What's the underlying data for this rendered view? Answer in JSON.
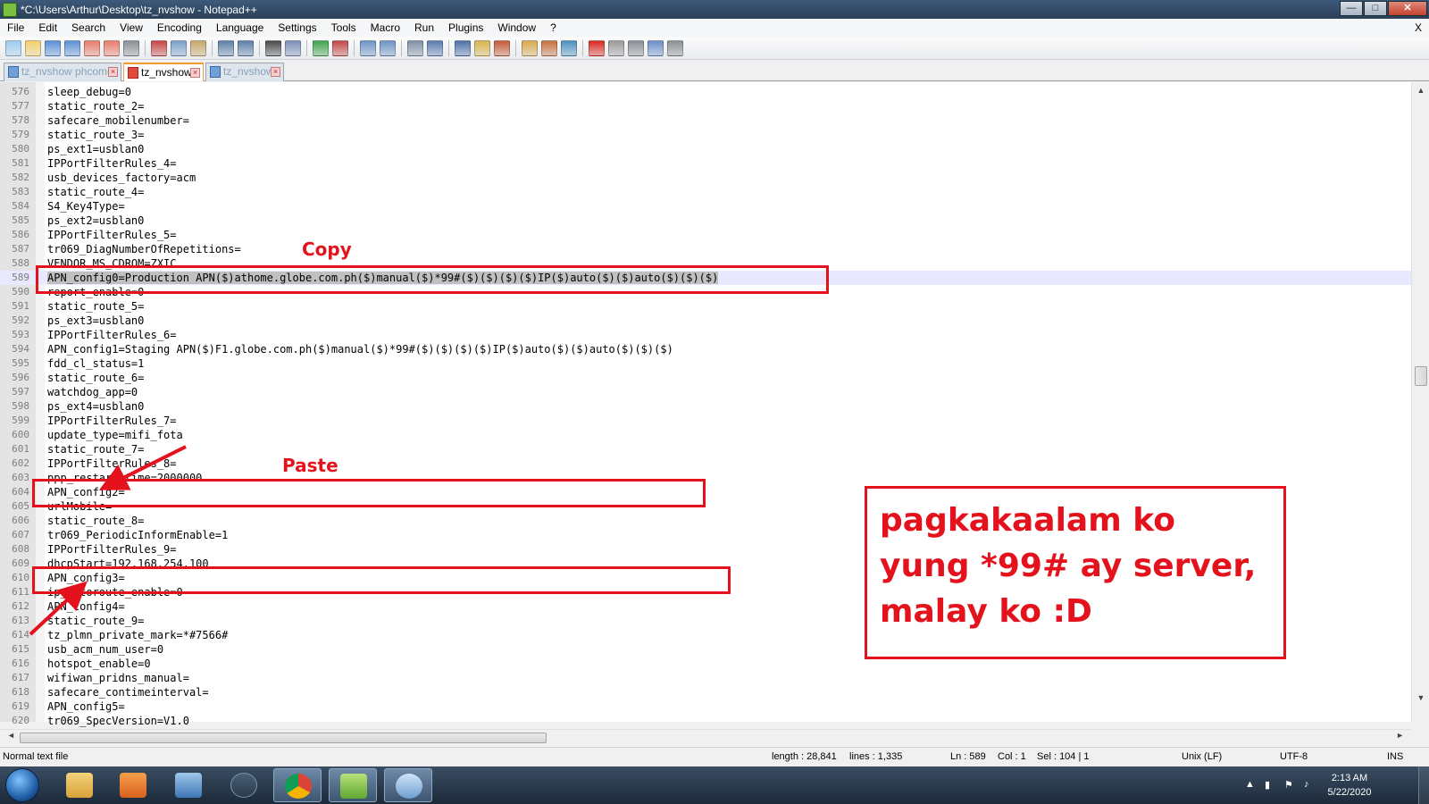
{
  "window": {
    "title": "*C:\\Users\\Arthur\\Desktop\\tz_nvshow - Notepad++",
    "controls": {
      "minimize": "—",
      "maximize": "□",
      "close": "✕"
    }
  },
  "menu": {
    "items": [
      "File",
      "Edit",
      "Search",
      "View",
      "Encoding",
      "Language",
      "Settings",
      "Tools",
      "Macro",
      "Run",
      "Plugins",
      "Window",
      "?"
    ],
    "doc_close": "X"
  },
  "toolbar": {
    "icons": [
      "new-file-icon",
      "open-file-icon",
      "save-icon",
      "save-all-icon",
      "close-icon",
      "close-all-icon",
      "print-icon",
      "cut-icon",
      "copy-icon",
      "paste-icon",
      "undo-icon",
      "redo-icon",
      "find-icon",
      "replace-icon",
      "zoom-in-icon",
      "zoom-out-icon",
      "sync-vertical-icon",
      "sync-horizontal-icon",
      "word-wrap-icon",
      "show-all-chars-icon",
      "indent-guide-icon",
      "udl-icon",
      "doc-map-icon",
      "function-list-icon",
      "folder-workspace-icon",
      "monitoring-icon",
      "record-macro-icon",
      "stop-macro-icon",
      "play-macro-icon",
      "run-macro-multiple-icon",
      "save-macro-icon"
    ]
  },
  "tabs": [
    {
      "label": "tz_nvshow phcomer",
      "active": false
    },
    {
      "label": "tz_nvshow",
      "active": true
    },
    {
      "label": "tz_nvshow",
      "active": false
    }
  ],
  "editor": {
    "current_line": "589",
    "lines": [
      {
        "n": "576",
        "text": "sleep_debug=0"
      },
      {
        "n": "577",
        "text": "static_route_2="
      },
      {
        "n": "578",
        "text": "safecare_mobilenumber="
      },
      {
        "n": "579",
        "text": "static_route_3="
      },
      {
        "n": "580",
        "text": "ps_ext1=usblan0"
      },
      {
        "n": "581",
        "text": "IPPortFilterRules_4="
      },
      {
        "n": "582",
        "text": "usb_devices_factory=acm"
      },
      {
        "n": "583",
        "text": "static_route_4="
      },
      {
        "n": "584",
        "text": "S4_Key4Type="
      },
      {
        "n": "585",
        "text": "ps_ext2=usblan0"
      },
      {
        "n": "586",
        "text": "IPPortFilterRules_5="
      },
      {
        "n": "587",
        "text": "tr069_DiagNumberOfRepetitions="
      },
      {
        "n": "588",
        "text": "VENDOR_MS_CDROM=ZXIC"
      },
      {
        "n": "589",
        "text": "APN_config0=Production APN($)athome.globe.com.ph($)manual($)*99#($)($)($)($)IP($)auto($)($)auto($)($)($)"
      },
      {
        "n": "590",
        "text": "report_enable=0"
      },
      {
        "n": "591",
        "text": "static_route_5="
      },
      {
        "n": "592",
        "text": "ps_ext3=usblan0"
      },
      {
        "n": "593",
        "text": "IPPortFilterRules_6="
      },
      {
        "n": "594",
        "text": "APN_config1=Staging APN($)F1.globe.com.ph($)manual($)*99#($)($)($)($)IP($)auto($)($)auto($)($)($)"
      },
      {
        "n": "595",
        "text": "fdd_cl_status=1"
      },
      {
        "n": "596",
        "text": "static_route_6="
      },
      {
        "n": "597",
        "text": "watchdog_app=0"
      },
      {
        "n": "598",
        "text": "ps_ext4=usblan0"
      },
      {
        "n": "599",
        "text": "IPPortFilterRules_7="
      },
      {
        "n": "600",
        "text": "update_type=mifi_fota"
      },
      {
        "n": "601",
        "text": "static_route_7="
      },
      {
        "n": "602",
        "text": "IPPortFilterRules_8="
      },
      {
        "n": "603",
        "text": "ppp_restart_time=2000000"
      },
      {
        "n": "604",
        "text": "APN_config2="
      },
      {
        "n": "605",
        "text": "urlMobile="
      },
      {
        "n": "606",
        "text": "static_route_8="
      },
      {
        "n": "607",
        "text": "tr069_PeriodicInformEnable=1"
      },
      {
        "n": "608",
        "text": "IPPortFilterRules_9="
      },
      {
        "n": "609",
        "text": "dhcpStart=192.168.254.100"
      },
      {
        "n": "610",
        "text": "APN_config3="
      },
      {
        "n": "611",
        "text": "ip_autoroute_enable=0"
      },
      {
        "n": "612",
        "text": "APN_config4="
      },
      {
        "n": "613",
        "text": "static_route_9="
      },
      {
        "n": "614",
        "text": "tz_plmn_private_mark=*#7566#"
      },
      {
        "n": "615",
        "text": "usb_acm_num_user=0"
      },
      {
        "n": "616",
        "text": "hotspot_enable=0"
      },
      {
        "n": "617",
        "text": "wifiwan_pridns_manual="
      },
      {
        "n": "618",
        "text": "safecare_contimeinterval="
      },
      {
        "n": "619",
        "text": "APN_config5="
      },
      {
        "n": "620",
        "text": "tr069_SpecVersion=V1.0"
      }
    ]
  },
  "scrollbar": {
    "up": "▲",
    "down": "▼",
    "left": "◄",
    "right": "►",
    "grip": "III"
  },
  "statusbar": {
    "file_type": "Normal text file",
    "length": "length : 28,841",
    "lines": "lines : 1,335",
    "ln": "Ln : 589",
    "col": "Col : 1",
    "sel": "Sel : 104 | 1",
    "eol": "Unix (LF)",
    "encoding": "UTF-8",
    "mode": "INS"
  },
  "annotations": {
    "copy_label": "Copy",
    "paste_label": "Paste",
    "note_lines": [
      "pagkakaalam ko",
      "yung *99# ay server,",
      "malay ko :D"
    ],
    "color": "#e3121c"
  },
  "taskbar": {
    "apps": [
      "file-explorer-icon",
      "media-player-icon",
      "remote-desktop-icon",
      "nox-icon",
      "chrome-icon",
      "notepad-plus-plus-icon",
      "paint-icon"
    ],
    "active_app": "notepad-plus-plus-icon",
    "time": "2:13 AM",
    "date": "5/22/2020",
    "tray_expand": "▲"
  }
}
